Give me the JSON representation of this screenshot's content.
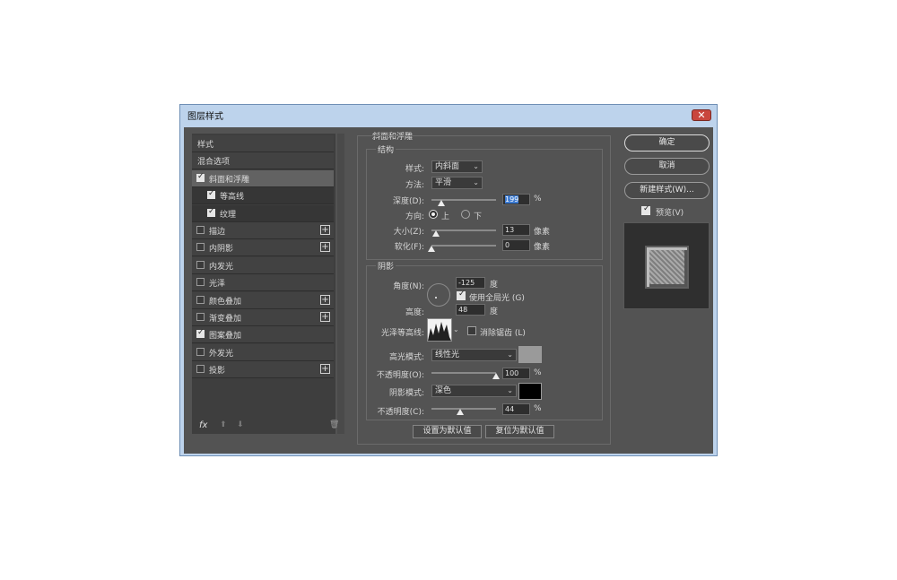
{
  "window": {
    "title": "图层样式",
    "close_glyph": "✕"
  },
  "styles_list": {
    "items": [
      {
        "label": "样式",
        "checkbox": false,
        "checked": false,
        "plus": false,
        "selected": false,
        "sub": false
      },
      {
        "label": "混合选项",
        "checkbox": false,
        "checked": false,
        "plus": false,
        "selected": false,
        "sub": false
      },
      {
        "label": "斜面和浮雕",
        "checkbox": true,
        "checked": true,
        "plus": false,
        "selected": true,
        "sub": false
      },
      {
        "label": "等高线",
        "checkbox": true,
        "checked": true,
        "plus": false,
        "selected": false,
        "sub": true
      },
      {
        "label": "纹理",
        "checkbox": true,
        "checked": true,
        "plus": false,
        "selected": false,
        "sub": true
      },
      {
        "label": "描边",
        "checkbox": true,
        "checked": false,
        "plus": true,
        "selected": false,
        "sub": false
      },
      {
        "label": "内阴影",
        "checkbox": true,
        "checked": false,
        "plus": true,
        "selected": false,
        "sub": false
      },
      {
        "label": "内发光",
        "checkbox": true,
        "checked": false,
        "plus": false,
        "selected": false,
        "sub": false
      },
      {
        "label": "光泽",
        "checkbox": true,
        "checked": false,
        "plus": false,
        "selected": false,
        "sub": false
      },
      {
        "label": "颜色叠加",
        "checkbox": true,
        "checked": false,
        "plus": true,
        "selected": false,
        "sub": false
      },
      {
        "label": "渐变叠加",
        "checkbox": true,
        "checked": false,
        "plus": true,
        "selected": false,
        "sub": false
      },
      {
        "label": "图案叠加",
        "checkbox": true,
        "checked": true,
        "plus": false,
        "selected": false,
        "sub": false
      },
      {
        "label": "外发光",
        "checkbox": true,
        "checked": false,
        "plus": false,
        "selected": false,
        "sub": false
      },
      {
        "label": "投影",
        "checkbox": true,
        "checked": false,
        "plus": true,
        "selected": false,
        "sub": false
      }
    ],
    "footer": {
      "fx_label": "fx",
      "up_glyph": "⬆",
      "down_glyph": "⬇",
      "trash_glyph": "🗑"
    }
  },
  "bevel": {
    "section_title": "斜面和浮雕",
    "structure": {
      "title": "结构",
      "style_label": "样式:",
      "style_value": "内斜面",
      "technique_label": "方法:",
      "technique_value": "平滑",
      "depth_label": "深度(D):",
      "depth_value": "199",
      "depth_unit": "%",
      "depth_level": 0.15,
      "direction_label": "方向:",
      "dir_up": "上",
      "dir_down": "下",
      "size_label": "大小(Z):",
      "size_value": "13",
      "size_unit": "像素",
      "size_level": 0.07,
      "soften_label": "软化(F):",
      "soften_value": "0",
      "soften_unit": "像素",
      "soften_level": 0
    },
    "shading": {
      "title": "阴影",
      "angle_label": "角度(N):",
      "angle_value": "-125",
      "angle_unit": "度",
      "global_light_label": "使用全局光 (G)",
      "altitude_label": "高度:",
      "altitude_value": "48",
      "altitude_unit": "度",
      "gloss_label": "光泽等高线:",
      "antialias_label": "消除锯齿 (L)",
      "highlight_mode_label": "高光模式:",
      "highlight_mode_value": "线性光",
      "highlight_color": "#9a9a9a",
      "highlight_opacity_label": "不透明度(O):",
      "highlight_opacity_value": "100",
      "highlight_opacity_unit": "%",
      "highlight_opacity_level": 1.0,
      "shadow_mode_label": "阴影模式:",
      "shadow_mode_value": "深色",
      "shadow_color": "#000000",
      "shadow_opacity_label": "不透明度(C):",
      "shadow_opacity_value": "44",
      "shadow_opacity_unit": "%",
      "shadow_opacity_level": 0.44
    },
    "make_default_label": "设置为默认值",
    "reset_default_label": "复位为默认值"
  },
  "right": {
    "ok_label": "确定",
    "cancel_label": "取消",
    "new_style_label": "新建样式(W)...",
    "preview_label": "预览(V)"
  }
}
